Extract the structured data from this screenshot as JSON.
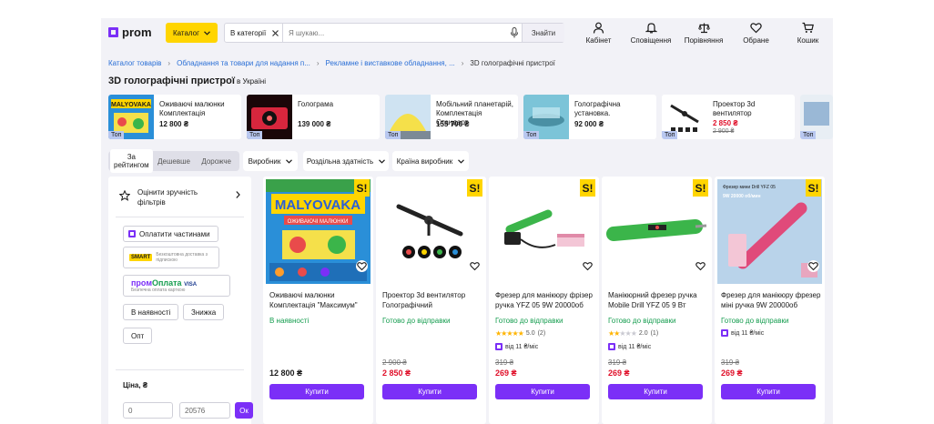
{
  "header": {
    "logo": "prom",
    "catalog_label": "Каталог",
    "search_category": "В категорії",
    "search_placeholder": "Я шукаю...",
    "search_button": "Знайти",
    "icons": [
      {
        "label": "Кабінет",
        "icon": "user-icon"
      },
      {
        "label": "Сповіщення",
        "icon": "bell-icon"
      },
      {
        "label": "Порівняння",
        "icon": "scales-icon"
      },
      {
        "label": "Обране",
        "icon": "heart-icon"
      },
      {
        "label": "Кошик",
        "icon": "cart-icon"
      }
    ]
  },
  "breadcrumb": [
    "Каталог товарів",
    "Обладнання та товари для надання п...",
    "Рекламне і виставкове обладнання, ...",
    "3D голографічні пристрої"
  ],
  "page_title": "3D голографічні пристрої",
  "page_title_suffix": "в Україні",
  "top_products": [
    {
      "title": "Оживаючі малюнки Комплектація",
      "price": "12 800 ₴",
      "badge": "Топ"
    },
    {
      "title": "Голограма",
      "price": "139 000 ₴",
      "badge": "Топ"
    },
    {
      "title": "Мобільний планетарій, Комплектація Стандарт",
      "price": "155 700 ₴",
      "badge": "Топ"
    },
    {
      "title": "Голографічна установка.",
      "price": "92 000 ₴",
      "badge": "Топ"
    },
    {
      "title": "Проектор 3d вентилятор",
      "price": "2 850 ₴",
      "old_price": "2 900 ₴",
      "badge": "Топ"
    },
    {
      "title": "",
      "price": "",
      "badge": "Топ"
    }
  ],
  "sort": {
    "options": [
      "За рейтингом",
      "Дешевше",
      "Дорожче"
    ],
    "active": 0
  },
  "filter_dropdowns": [
    "Виробник",
    "Роздільна здатність",
    "Країна виробник"
  ],
  "sidebar": {
    "rate_filters": "Оцінити зручність фільтрів",
    "pay_parts": "Оплатити частинами",
    "smart_logo": "SMART",
    "smart_text": "Безкоштовна доставка з підпискою",
    "prom_pay_a": "пром",
    "prom_pay_b": "Оплата",
    "prom_pay_visa": "VISA",
    "prom_pay_sub": "Безпечна оплата карткою",
    "chips": [
      "В наявності",
      "Знижка",
      "Опт"
    ],
    "price_label": "Ціна, ₴",
    "price_from": "0",
    "price_to": "20576",
    "ok": "Ок"
  },
  "products": [
    {
      "title": "Оживаючі малюнки Комплектація \"Максимум\"",
      "availability": "В наявності",
      "price": "12 800 ₴",
      "old_price": "",
      "rating": "",
      "reviews": "",
      "installment": "",
      "buy": "Купити",
      "img_caption": "MALYOVAKA",
      "img_sub": "ОЖИВАЮЧІ МАЛЮНКИ"
    },
    {
      "title": "Проектор 3d вентилятор Голографічний Світлодіодний",
      "availability": "Готово до відправки",
      "price": "2 850 ₴",
      "old_price": "2 900 ₴",
      "rating": "",
      "reviews": "",
      "installment": "",
      "buy": "Купити",
      "img_caption": "",
      "img_sub": ""
    },
    {
      "title": "Фрезер для манікюру фрізер ручка YFZ 05 9W 20000об",
      "availability": "Готово до відправки",
      "price": "269 ₴",
      "old_price": "319 ₴",
      "rating": "5.0",
      "reviews": "(2)",
      "installment": "від 11 ₴/міс",
      "buy": "Купити",
      "img_caption": "",
      "img_sub": ""
    },
    {
      "title": "Манікюрний фрезер ручка Mobile Drill YFZ 05 9 Вт",
      "availability": "Готово до відправки",
      "price": "269 ₴",
      "old_price": "319 ₴",
      "rating": "2.0",
      "reviews": "(1)",
      "installment": "від 11 ₴/міс",
      "buy": "Купити",
      "img_caption": "",
      "img_sub": ""
    },
    {
      "title": "Фрезер для манікюру фрезер міні ручка 9W 20000об",
      "availability": "Готово до відправки",
      "price": "269 ₴",
      "old_price": "319 ₴",
      "rating": "",
      "reviews": "",
      "installment": "від 11 ₴/міс",
      "buy": "Купити",
      "img_caption": "Фрезер мини Drill YFZ 05",
      "img_sub": "9W 20000 об/мин"
    }
  ],
  "colors": {
    "accent": "#7b2ff7",
    "catalog": "#ffd500",
    "price_red": "#e0102a",
    "available_green": "#159d4f"
  }
}
